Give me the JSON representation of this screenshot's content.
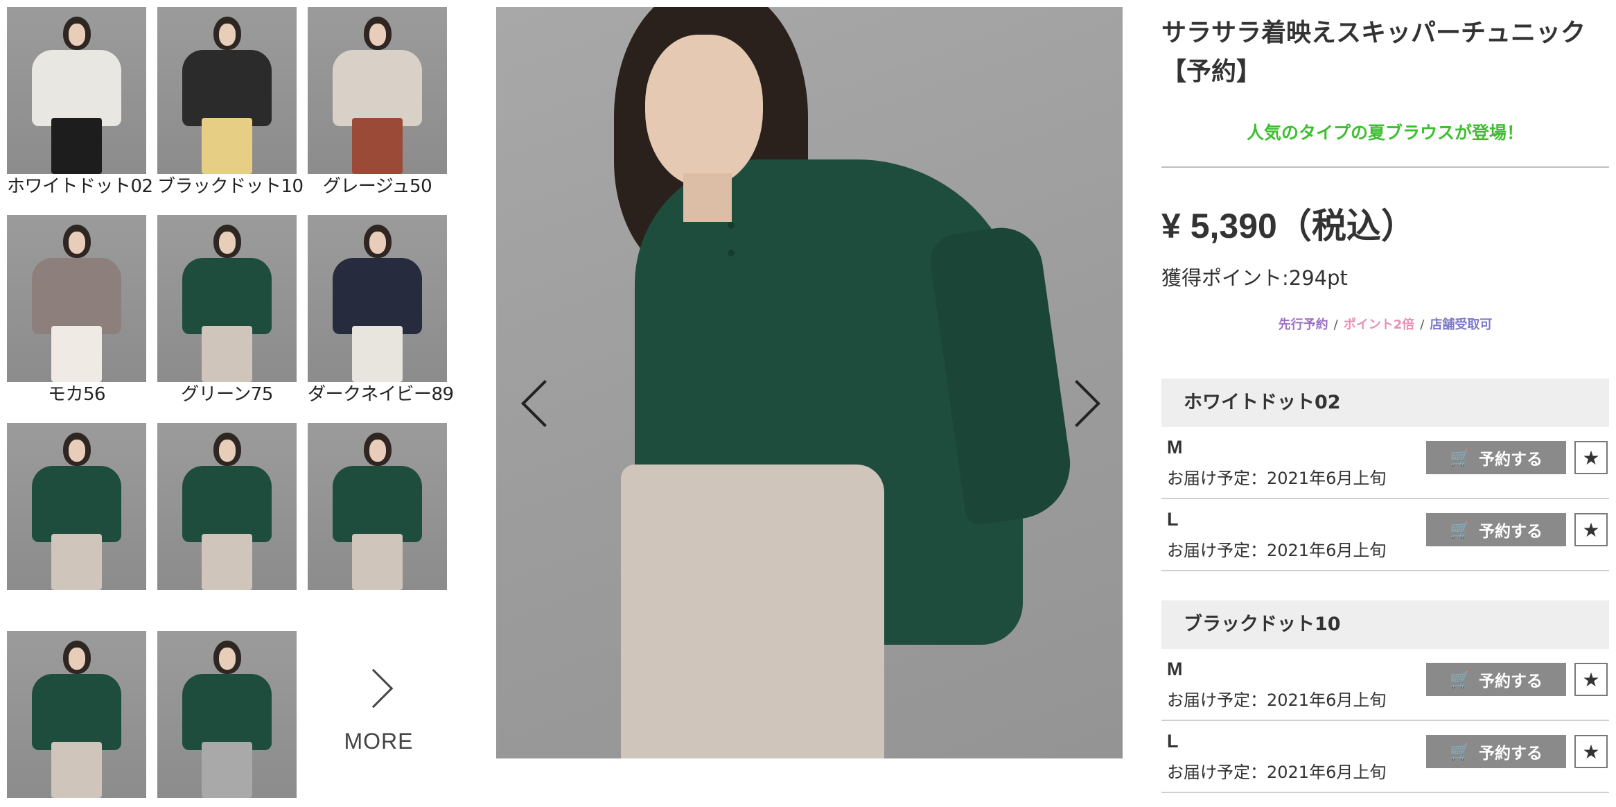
{
  "thumbnails": [
    {
      "caption": "ホワイトドット02",
      "top_color": "#e9e7e2",
      "bottom_color": "#1d1d1d"
    },
    {
      "caption": "ブラックドット10",
      "top_color": "#2b2b2b",
      "bottom_color": "#e6cf84"
    },
    {
      "caption": "グレージュ50",
      "top_color": "#d9d1c7",
      "bottom_color": "#9a4a36"
    },
    {
      "caption": "モカ56",
      "top_color": "#8d7f7b",
      "bottom_color": "#efeae3"
    },
    {
      "caption": "グリーン75",
      "top_color": "#1f4d3d",
      "bottom_color": "#cfc5ba"
    },
    {
      "caption": "ダークネイビー89",
      "top_color": "#262c3e",
      "bottom_color": "#e8e5df"
    },
    {
      "caption": "",
      "top_color": "#1f4d3d",
      "bottom_color": "#cfc5ba"
    },
    {
      "caption": "",
      "top_color": "#1f4d3d",
      "bottom_color": "#cfc5ba"
    },
    {
      "caption": "",
      "top_color": "#1f4d3d",
      "bottom_color": "#cfc5ba"
    },
    {
      "caption": "",
      "top_color": "#1f4d3d",
      "bottom_color": "#cfc5ba"
    },
    {
      "caption": "",
      "top_color": "#1f4d3d",
      "bottom_color": "#a9a9a9"
    }
  ],
  "more_label": "MORE",
  "product": {
    "title": "サラサラ着映えスキッパーチュニック【予約】",
    "catch_copy": "人気のタイプの夏ブラウスが登場！",
    "price": "¥ 5,390（税込）",
    "points": "獲得ポイント:294pt",
    "tags": [
      "先行予約",
      "ポイント2倍",
      "店舗受取可"
    ],
    "tag_separator": "/"
  },
  "colors": [
    {
      "name": "ホワイトドット02",
      "sizes": [
        {
          "size": "M",
          "delivery": "お届け予定：2021年6月上旬",
          "button": "予約する"
        },
        {
          "size": "L",
          "delivery": "お届け予定：2021年6月上旬",
          "button": "予約する"
        }
      ]
    },
    {
      "name": "ブラックドット10",
      "sizes": [
        {
          "size": "M",
          "delivery": "お届け予定：2021年6月上旬",
          "button": "予約する"
        },
        {
          "size": "L",
          "delivery": "お届け予定：2021年6月上旬",
          "button": "予約する"
        }
      ]
    }
  ],
  "icons": {
    "cart": "cart-icon",
    "favorite": "star-icon",
    "prev": "chevron-left-icon",
    "next": "chevron-right-icon"
  }
}
